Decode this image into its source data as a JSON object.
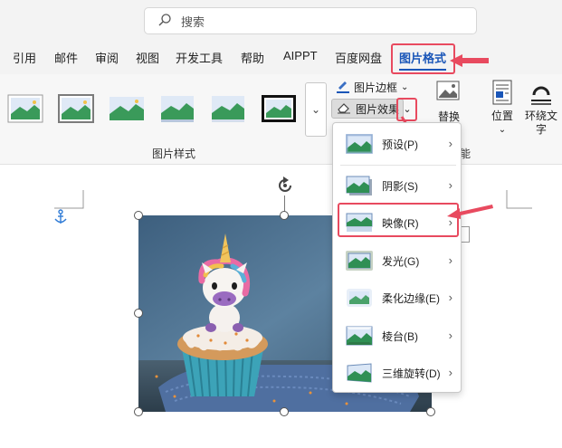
{
  "search": {
    "placeholder": "搜索"
  },
  "tabs": {
    "cite": "引用",
    "mail": "邮件",
    "review": "审阅",
    "view": "视图",
    "developer": "开发工具",
    "help": "帮助",
    "aippt": "AIPPT",
    "baidu": "百度网盘",
    "picture_format": "图片格式"
  },
  "ribbon": {
    "styles_group_label": "图片样式",
    "border_label": "图片边框",
    "effects_label": "图片效果",
    "replace_label": "替换",
    "position_label": "位置",
    "wrap_label_1": "环绕文",
    "wrap_label_2": "字",
    "partial_group_label": "能"
  },
  "effects_menu": {
    "items": [
      {
        "label": "预设(P)"
      },
      {
        "label": "阴影(S)"
      },
      {
        "label": "映像(R)"
      },
      {
        "label": "发光(G)"
      },
      {
        "label": "柔化边缘(E)"
      },
      {
        "label": "棱台(B)"
      },
      {
        "label": "三维旋转(D)"
      }
    ]
  },
  "colors": {
    "accent": "#1a56b8",
    "highlight": "#e84a5f"
  }
}
